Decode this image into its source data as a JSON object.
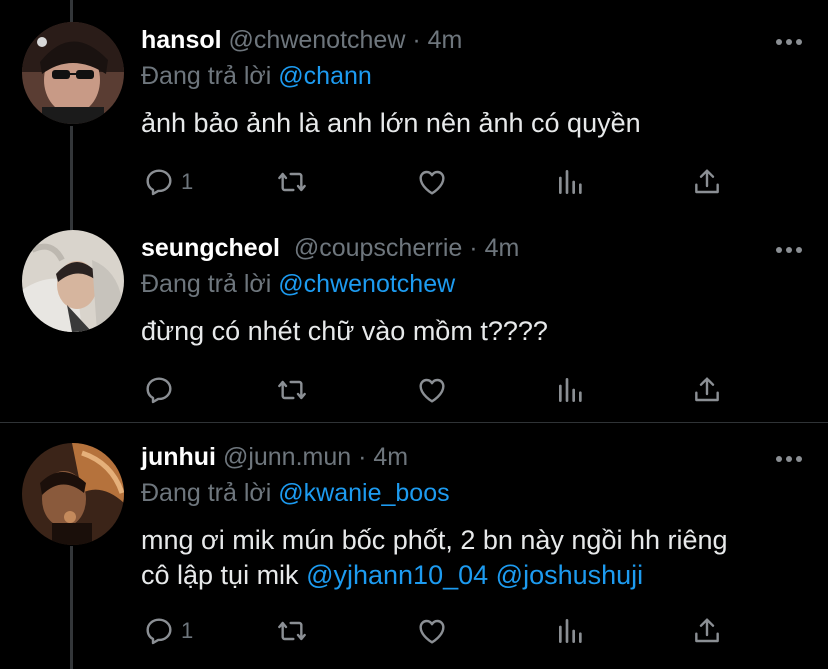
{
  "tweets": [
    {
      "name": "hansol",
      "handle": "@chwenotchew",
      "dot": "·",
      "time": "4m",
      "reply_prefix": "Đang trả lời",
      "reply_to": "@chann",
      "text": "ảnh bảo ảnh là anh lớn nên ảnh có quyền",
      "reply_count": "1"
    },
    {
      "name": "seungcheol",
      "handle": "@coupscherrie",
      "dot": "·",
      "time": "4m",
      "reply_prefix": "Đang trả lời",
      "reply_to": "@chwenotchew",
      "text": "đừng có nhét chữ vào mồm t????",
      "reply_count": ""
    },
    {
      "name": "junhui",
      "handle": "@junn.mun",
      "dot": "·",
      "time": "4m",
      "reply_prefix": "Đang trả lời",
      "reply_to": "@kwanie_boos",
      "text_line1": "mng ơi mik mún bốc phốt, 2 bn này ngồi hh riêng",
      "text_line2_prefix": "cô lập tụi mik",
      "mention_a": "@yjhann10_04",
      "mention_b": "@joshushuji",
      "reply_count": "1"
    }
  ],
  "colors": {
    "background": "#000000",
    "name": "#ffffff",
    "meta": "#6e767d",
    "link": "#1d9bf0",
    "divider": "#2f3336"
  },
  "icons": [
    "reply-icon",
    "retweet-icon",
    "like-icon",
    "analytics-icon",
    "share-icon",
    "more-icon"
  ]
}
